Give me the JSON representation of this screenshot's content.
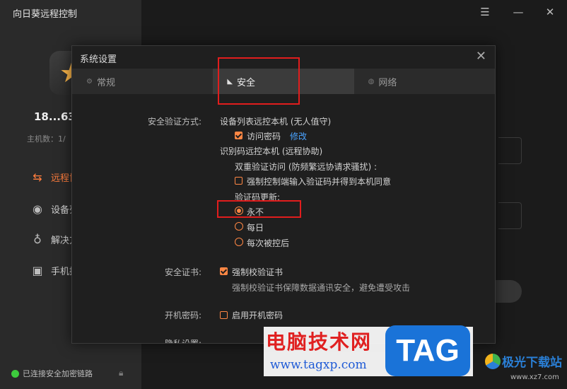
{
  "app": {
    "title": "向日葵远程控制",
    "window_buttons": {
      "menu_icon": "☰",
      "minimize_icon": "—",
      "close_icon": "✕"
    }
  },
  "sidebar": {
    "device_id": "18...63",
    "host_count": "主机数：1/",
    "nav_items": [
      {
        "label": "远程协",
        "icon": "remote-arrows-icon",
        "active": true
      },
      {
        "label": "设备列",
        "icon": "device-icon",
        "active": false
      },
      {
        "label": "解决方",
        "icon": "satellite-icon",
        "active": false
      },
      {
        "label": "手机投",
        "icon": "cast-icon",
        "active": false
      }
    ],
    "status_text": "已连接安全加密链路"
  },
  "dialog": {
    "title": "系统设置",
    "close_icon": "✕",
    "tabs": [
      {
        "label": "常规",
        "active": false
      },
      {
        "label": "安全",
        "active": true
      },
      {
        "label": "网络",
        "active": false
      }
    ],
    "security_auth": {
      "label": "安全验证方式:",
      "device_list_header": "设备列表远控本机 (无人值守)",
      "access_password_label": "访问密码",
      "access_password_checked": true,
      "modify_link": "修改",
      "id_code_header": "识别码远控本机 (远程协助)",
      "double_verify_label": "双重验证访问 (防频繁远协请求骚扰) :",
      "force_verify_label": "强制控制端输入验证码并得到本机同意",
      "force_verify_checked": false,
      "code_update_label": "验证码更新:",
      "code_update_options": [
        "永不",
        "每日",
        "每次被控后"
      ],
      "code_update_selected": "永不"
    },
    "security_cert": {
      "label": "安全证书:",
      "force_cert_label": "强制校验证书",
      "force_cert_checked": true,
      "desc": "强制校验证书保障数据通讯安全，避免遭受攻击"
    },
    "boot_password": {
      "label": "开机密码:",
      "enable_label": "启用开机密码",
      "enable_checked": false
    },
    "privacy": {
      "label": "隐私设置:"
    }
  },
  "watermark": {
    "site_cn": "电脑技术网",
    "site_url": "www.tagxp.com",
    "tag_text": "TAG",
    "xz_cn": "极光下载站",
    "xz_url": "www.xz7.com"
  },
  "colors": {
    "accent": "#ff8744",
    "link": "#4aa3ff",
    "highlight": "#e11d1d",
    "status_ok": "#3dcc3d"
  }
}
